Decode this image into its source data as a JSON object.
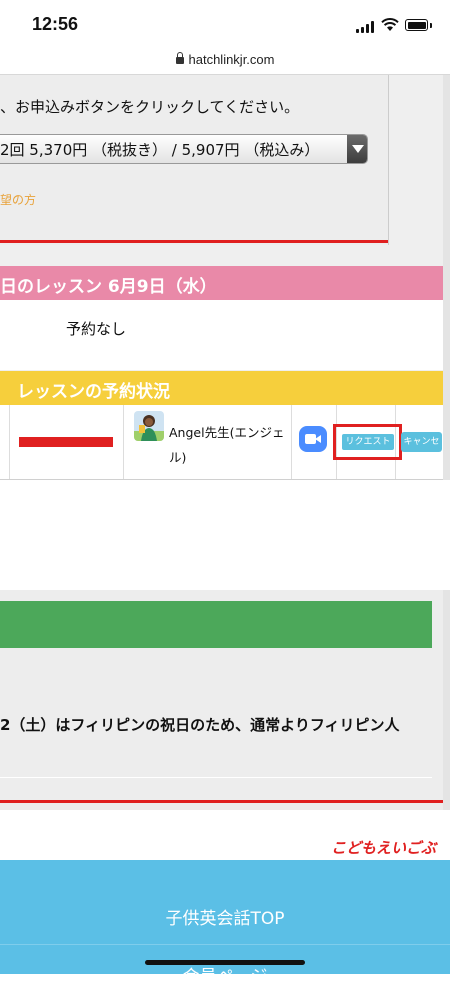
{
  "status_bar": {
    "time": "12:56"
  },
  "browser": {
    "url": "hatchlinkjr.com"
  },
  "booking_form": {
    "instruction": "、お申込みボタンをクリックしてください。",
    "plan_select_value": "2回  5,370円  （税抜き） /   5,907円  （税込み）",
    "hope_link": "望の方"
  },
  "today_lesson": {
    "header": "日のレッスン 6月9日（水）",
    "status": "予約なし"
  },
  "reservation_status": {
    "header": "レッスンの予約状況",
    "row": {
      "teacher_name": "Angel先生(エンジェル)",
      "request_label": "リクエスト",
      "cancel_label": "キャンセル"
    }
  },
  "news": {
    "notice": "2（土）はフィリピンの祝日のため、通常よりフィリピン人"
  },
  "brand": "こどもえいごぶ",
  "footer": {
    "top_link": "子供英会話TOP",
    "member_link": "会員ページ"
  },
  "colors": {
    "today_header": "#e989a8",
    "status_header": "#f6cf3c",
    "green_bar": "#4ca85a",
    "footer": "#5bbfe6",
    "accent_red": "#e02020",
    "button": "#5bc0de"
  }
}
